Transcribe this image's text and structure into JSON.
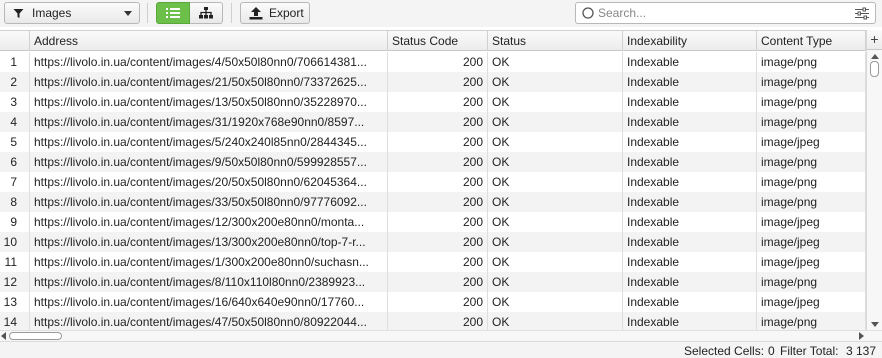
{
  "toolbar": {
    "filter_label": "Images",
    "export_label": "Export",
    "search_placeholder": "Search..."
  },
  "table": {
    "columns": [
      "Address",
      "Status Code",
      "Status",
      "Indexability",
      "Content Type"
    ],
    "rows": [
      {
        "n": "1",
        "address": "https://livolo.in.ua/content/images/4/50x50l80nn0/706614381...",
        "code": "200",
        "status": "OK",
        "indexability": "Indexable",
        "type": "image/png"
      },
      {
        "n": "2",
        "address": "https://livolo.in.ua/content/images/21/50x50l80nn0/73372625...",
        "code": "200",
        "status": "OK",
        "indexability": "Indexable",
        "type": "image/png"
      },
      {
        "n": "3",
        "address": "https://livolo.in.ua/content/images/13/50x50l80nn0/35228970...",
        "code": "200",
        "status": "OK",
        "indexability": "Indexable",
        "type": "image/png"
      },
      {
        "n": "4",
        "address": "https://livolo.in.ua/content/images/31/1920x768e90nn0/8597...",
        "code": "200",
        "status": "OK",
        "indexability": "Indexable",
        "type": "image/png"
      },
      {
        "n": "5",
        "address": "https://livolo.in.ua/content/images/5/240x240l85nn0/2844345...",
        "code": "200",
        "status": "OK",
        "indexability": "Indexable",
        "type": "image/jpeg"
      },
      {
        "n": "6",
        "address": "https://livolo.in.ua/content/images/9/50x50l80nn0/599928557...",
        "code": "200",
        "status": "OK",
        "indexability": "Indexable",
        "type": "image/png"
      },
      {
        "n": "7",
        "address": "https://livolo.in.ua/content/images/20/50x50l80nn0/62045364...",
        "code": "200",
        "status": "OK",
        "indexability": "Indexable",
        "type": "image/png"
      },
      {
        "n": "8",
        "address": "https://livolo.in.ua/content/images/33/50x50l80nn0/97776092...",
        "code": "200",
        "status": "OK",
        "indexability": "Indexable",
        "type": "image/png"
      },
      {
        "n": "9",
        "address": "https://livolo.in.ua/content/images/12/300x200e80nn0/monta...",
        "code": "200",
        "status": "OK",
        "indexability": "Indexable",
        "type": "image/jpeg"
      },
      {
        "n": "10",
        "address": "https://livolo.in.ua/content/images/13/300x200e80nn0/top-7-r...",
        "code": "200",
        "status": "OK",
        "indexability": "Indexable",
        "type": "image/jpeg"
      },
      {
        "n": "11",
        "address": "https://livolo.in.ua/content/images/1/300x200e80nn0/suchasn...",
        "code": "200",
        "status": "OK",
        "indexability": "Indexable",
        "type": "image/jpeg"
      },
      {
        "n": "12",
        "address": "https://livolo.in.ua/content/images/8/110x110l80nn0/2389923...",
        "code": "200",
        "status": "OK",
        "indexability": "Indexable",
        "type": "image/png"
      },
      {
        "n": "13",
        "address": "https://livolo.in.ua/content/images/16/640x640e90nn0/17760...",
        "code": "200",
        "status": "OK",
        "indexability": "Indexable",
        "type": "image/jpeg"
      },
      {
        "n": "14",
        "address": "https://livolo.in.ua/content/images/47/50x50l80nn0/80922044...",
        "code": "200",
        "status": "OK",
        "indexability": "Indexable",
        "type": "image/png"
      }
    ]
  },
  "statusbar": {
    "selected_label": "Selected Cells:",
    "selected_value": "0",
    "filter_label": "Filter Total:",
    "filter_value": "3 137"
  },
  "colors": {
    "accent": "#6cc04a",
    "row_alt": "#f3f3f3"
  }
}
